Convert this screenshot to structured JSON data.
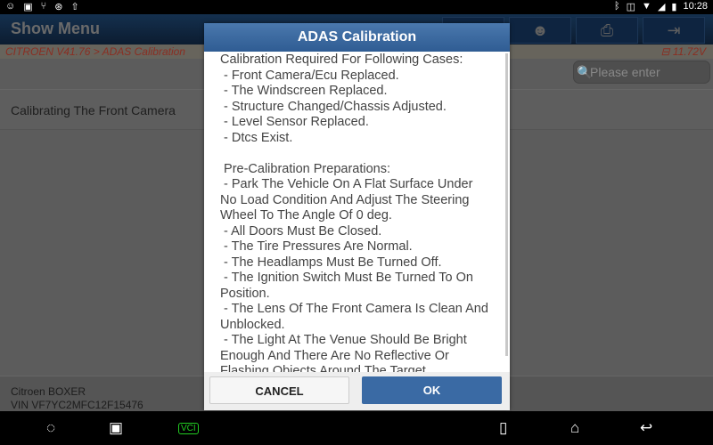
{
  "status_bar": {
    "time": "10:28",
    "left_icons": [
      "chat-icon",
      "image-icon",
      "usb-icon",
      "settings-icon",
      "upload-icon"
    ],
    "right_icons": [
      "bluetooth-icon",
      "vibrate-icon",
      "wifi-icon",
      "signal-icon",
      "battery-icon"
    ]
  },
  "header": {
    "title": "Show Menu",
    "buttons": [
      "help-icon",
      "support-icon",
      "print-icon",
      "exit-icon"
    ]
  },
  "breadcrumb": {
    "text": "CITROEN V41.76 > ADAS Calibration",
    "voltage": "11.72V"
  },
  "search": {
    "placeholder": "Please enter keyword"
  },
  "list": {
    "items": [
      "Calibrating The Front Camera"
    ]
  },
  "vehicle": {
    "model": "Citroen BOXER",
    "vin": "VIN VF7YC2MFC12F15476"
  },
  "dialog": {
    "title": "ADAS Calibration",
    "lines": [
      "Calibration Required For Following Cases:",
      " - Front Camera/Ecu Replaced.",
      " - The Windscreen Replaced.",
      " - Structure Changed/Chassis Adjusted.",
      " - Level Sensor Replaced.",
      " - Dtcs Exist.",
      "",
      " Pre-Calibration Preparations:",
      " - Park The Vehicle On A Flat Surface Under",
      "No Load Condition And Adjust The Steering",
      "Wheel To The Angle Of 0 deg.",
      " - All Doors Must Be Closed.",
      " - The Tire Pressures Are Normal.",
      " - The Headlamps Must Be Turned Off.",
      " - The Ignition Switch Must Be Turned To On",
      "Position.",
      " - The Lens Of The Front Camera Is Clean And",
      "Unblocked.",
      " - The Light At The Venue Should Be Bright",
      "Enough And There Are No Reflective Or",
      "Flashing Objects Around The Target."
    ],
    "cancel": "CANCEL",
    "ok": "OK"
  },
  "nav": {
    "vci_label": "VCI"
  },
  "colors": {
    "dialog_title": "#3a6aa4",
    "breadcrumb_text": "#8a2e22",
    "vci": "#22cc22"
  }
}
